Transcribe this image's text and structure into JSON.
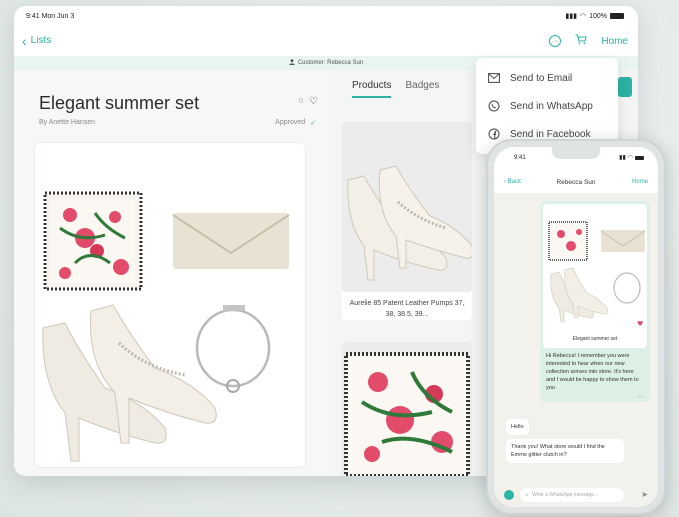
{
  "tablet": {
    "status": {
      "time": "9:41 Mon Jun 3",
      "battery": "100%"
    },
    "nav": {
      "back_label": "Lists",
      "home_label": "Home"
    },
    "customer_label": "Customer: Rebecca Sun",
    "set": {
      "title": "Elegant summer set",
      "byline": "By Anette Hansen",
      "likes": "0",
      "status": "Approved"
    },
    "tabs": [
      {
        "label": "Products",
        "active": true
      },
      {
        "label": "Badges",
        "active": false
      }
    ],
    "products": [
      {
        "name": "Aurelie 85 Patent Leather Pumps 37, 38, 38.5, 39..."
      }
    ],
    "share_menu": [
      {
        "label": "Send to Email",
        "icon": "mail-icon"
      },
      {
        "label": "Send in WhatsApp",
        "icon": "whatsapp-icon"
      },
      {
        "label": "Send in Facebook",
        "icon": "facebook-icon"
      }
    ]
  },
  "phone": {
    "status": {
      "time": "9:41"
    },
    "nav": {
      "back_label": "Back",
      "title": "Rebecca Sun",
      "home_label": "Home"
    },
    "messages": {
      "card_caption": "Elegant summer set",
      "outgoing_text": "Hi Rebecca! I remember you were interested to hear when our new collection arrives into store. It's here and I would be happy to show them to you",
      "incoming_1": "Hello",
      "incoming_2": "Thank you! What store would I find the Emme glitter clutch in?"
    },
    "input_placeholder": "Write a WhatsApp message..."
  },
  "colors": {
    "accent": "#2bb3a3",
    "customer_bar": "#e9f5f3",
    "chat_bg": "#f3f1ec",
    "bubble_out": "#dcf0e6"
  }
}
